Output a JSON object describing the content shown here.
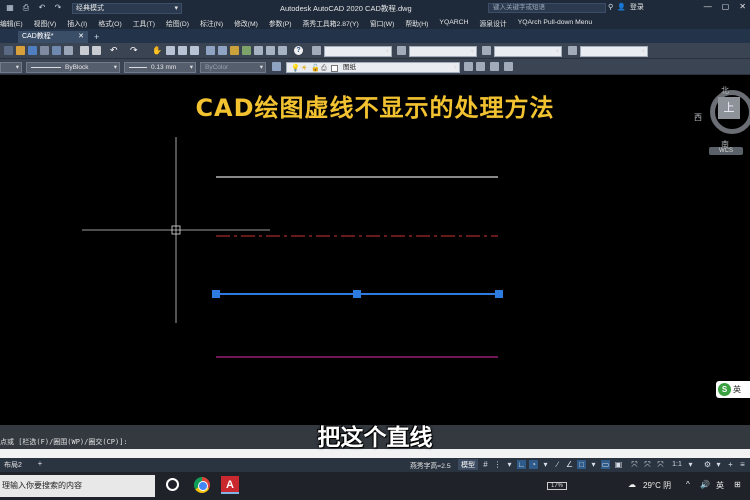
{
  "titlebar": {
    "workspace": "经典模式",
    "app_title": "Autodesk AutoCAD 2020    CAD教程.dwg",
    "search_placeholder": "键入关键字或短语",
    "login": "登录"
  },
  "menu": {
    "items": [
      "编辑(E)",
      "视图(V)",
      "插入(I)",
      "格式(O)",
      "工具(T)",
      "绘图(D)",
      "标注(N)",
      "修改(M)",
      "参数(P)",
      "燕秀工具箱2.87(Y)",
      "窗口(W)",
      "帮助(H)",
      "YQARCH",
      "源泉设计",
      "YQArch Pull-down Menu"
    ]
  },
  "tabs": {
    "active": "CAD教程*"
  },
  "toolbar": {
    "linetype": "ByBlock",
    "lineweight": "0.13 mm",
    "plotstyle": "ByColor",
    "layer": "图纸"
  },
  "canvas": {
    "heading": "CAD绘图虚线不显示的处理方法",
    "subtitle": "把这个直线",
    "accent": "#f2c230",
    "line_colors": {
      "solid_white": "#d9d9d9",
      "dashed_red": "#a52a2a",
      "selected_blue": "#2e7be0",
      "magenta": "#b5238a"
    }
  },
  "viewcube": {
    "north": "北",
    "west": "西",
    "south": "南",
    "face": "上",
    "wcs": "WCS"
  },
  "ime": {
    "label": "英"
  },
  "command": {
    "prompt": "点或 [栏选(F)/圈围(WP)/圈交(CP)]:"
  },
  "statusbar": {
    "layout": "布局2",
    "text_scale": "燕秀字高=2.5",
    "model": "模型",
    "scale": "1:1"
  },
  "taskbar": {
    "search": "理输入你要搜索的内容",
    "battery": "17%",
    "weather": "29°C 阴",
    "lang": "英"
  }
}
